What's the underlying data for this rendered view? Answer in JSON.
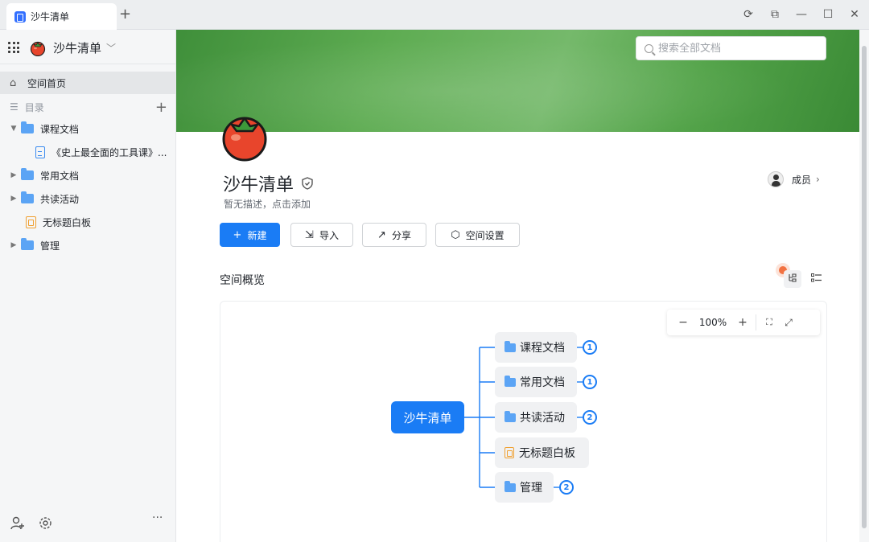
{
  "window": {
    "tab_title": "沙牛清单",
    "tab_add": "+",
    "controls": {
      "sync": "⟳",
      "window": "⧉",
      "minimize": "—",
      "maximize": "☐",
      "close": "✕"
    }
  },
  "sidebar": {
    "space_name": "沙牛清单",
    "home_label": "空间首页",
    "directory_label": "目录",
    "tree": [
      {
        "label": "课程文档",
        "type": "folder",
        "expanded": true
      },
      {
        "label": "《史上最全面的工具课》...",
        "type": "doc"
      },
      {
        "label": "常用文档",
        "type": "folder",
        "expanded": false
      },
      {
        "label": "共读活动",
        "type": "folder",
        "expanded": false
      },
      {
        "label": "无标题白板",
        "type": "board"
      },
      {
        "label": "管理",
        "type": "folder",
        "expanded": false
      }
    ],
    "bottom": {
      "more": "···"
    }
  },
  "header": {
    "search_placeholder": "搜索全部文档",
    "space_title": "沙牛清单",
    "description": "暂无描述，点击添加",
    "members_label": "成员"
  },
  "actions": {
    "new_label": "新建",
    "import_label": "导入",
    "share_label": "分享",
    "settings_label": "空间设置"
  },
  "overview": {
    "label": "空间概览",
    "zoom": "100%",
    "mindmap": {
      "root": "沙牛清单",
      "children": [
        {
          "label": "课程文档",
          "type": "folder",
          "count": "1"
        },
        {
          "label": "常用文档",
          "type": "folder",
          "count": "1"
        },
        {
          "label": "共读活动",
          "type": "folder",
          "count": "2"
        },
        {
          "label": "无标题白板",
          "type": "board",
          "count": ""
        },
        {
          "label": "管理",
          "type": "folder",
          "count": "2"
        }
      ]
    }
  },
  "colors": {
    "primary": "#1a7cf5",
    "folder": "#5ba4f5",
    "banner": "#5eac52",
    "tomato": "#e8452c"
  }
}
